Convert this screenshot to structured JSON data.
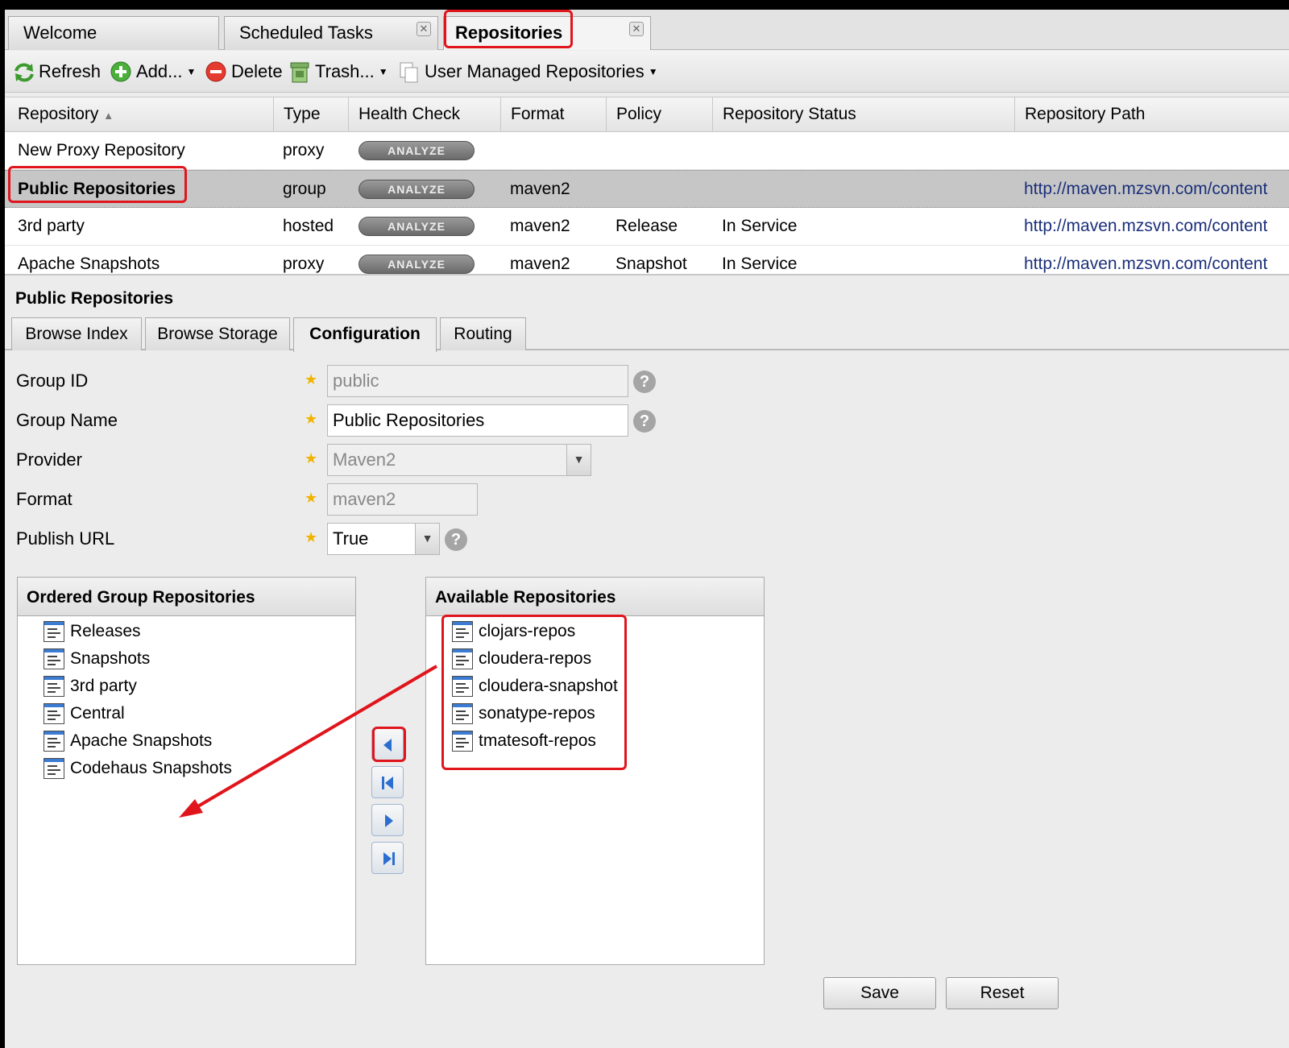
{
  "top_tabs": [
    {
      "label": "Welcome"
    },
    {
      "label": "Scheduled Tasks"
    },
    {
      "label": "Repositories"
    }
  ],
  "toolbar": {
    "refresh": "Refresh",
    "add": "Add...",
    "delete": "Delete",
    "trash": "Trash...",
    "user_managed": "User Managed Repositories"
  },
  "grid": {
    "columns": [
      "Repository",
      "Type",
      "Health Check",
      "Format",
      "Policy",
      "Repository Status",
      "Repository Path"
    ],
    "analyze_label": "ANALYZE",
    "rows": [
      {
        "name": "New Proxy Repository",
        "type": "proxy",
        "format": "",
        "policy": "",
        "status": "",
        "path": ""
      },
      {
        "name": "Public Repositories",
        "type": "group",
        "format": "maven2",
        "policy": "",
        "status": "",
        "path": "http://maven.mzsvn.com/content"
      },
      {
        "name": "3rd party",
        "type": "hosted",
        "format": "maven2",
        "policy": "Release",
        "status": "In Service",
        "path": "http://maven.mzsvn.com/content"
      },
      {
        "name": "Apache Snapshots",
        "type": "proxy",
        "format": "maven2",
        "policy": "Snapshot",
        "status": "In Service",
        "path": "http://maven.mzsvn.com/content"
      }
    ]
  },
  "detail": {
    "title": "Public Repositories",
    "tabs": [
      "Browse Index",
      "Browse Storage",
      "Configuration",
      "Routing"
    ],
    "form": {
      "group_id_label": "Group ID",
      "group_id_value": "public",
      "group_name_label": "Group Name",
      "group_name_value": "Public Repositories",
      "provider_label": "Provider",
      "provider_value": "Maven2",
      "format_label": "Format",
      "format_value": "maven2",
      "publish_url_label": "Publish URL",
      "publish_url_value": "True"
    },
    "ordered": {
      "title": "Ordered Group Repositories",
      "items": [
        "Releases",
        "Snapshots",
        "3rd party",
        "Central",
        "Apache Snapshots",
        "Codehaus Snapshots"
      ]
    },
    "available": {
      "title": "Available Repositories",
      "items": [
        "clojars-repos",
        "cloudera-repos",
        "cloudera-snapshot",
        "sonatype-repos",
        "tmatesoft-repos"
      ]
    },
    "save": "Save",
    "reset": "Reset"
  },
  "colors": {
    "highlight": "#e0151c",
    "link": "#1a2f7a",
    "selected_row": "#c6c6c6"
  },
  "icons": [
    "refresh-icon",
    "add-icon",
    "delete-icon",
    "trash-icon",
    "user-managed-icon",
    "repository-icon",
    "help-icon",
    "move-left-icon",
    "move-first-icon",
    "move-right-icon",
    "move-last-icon"
  ]
}
